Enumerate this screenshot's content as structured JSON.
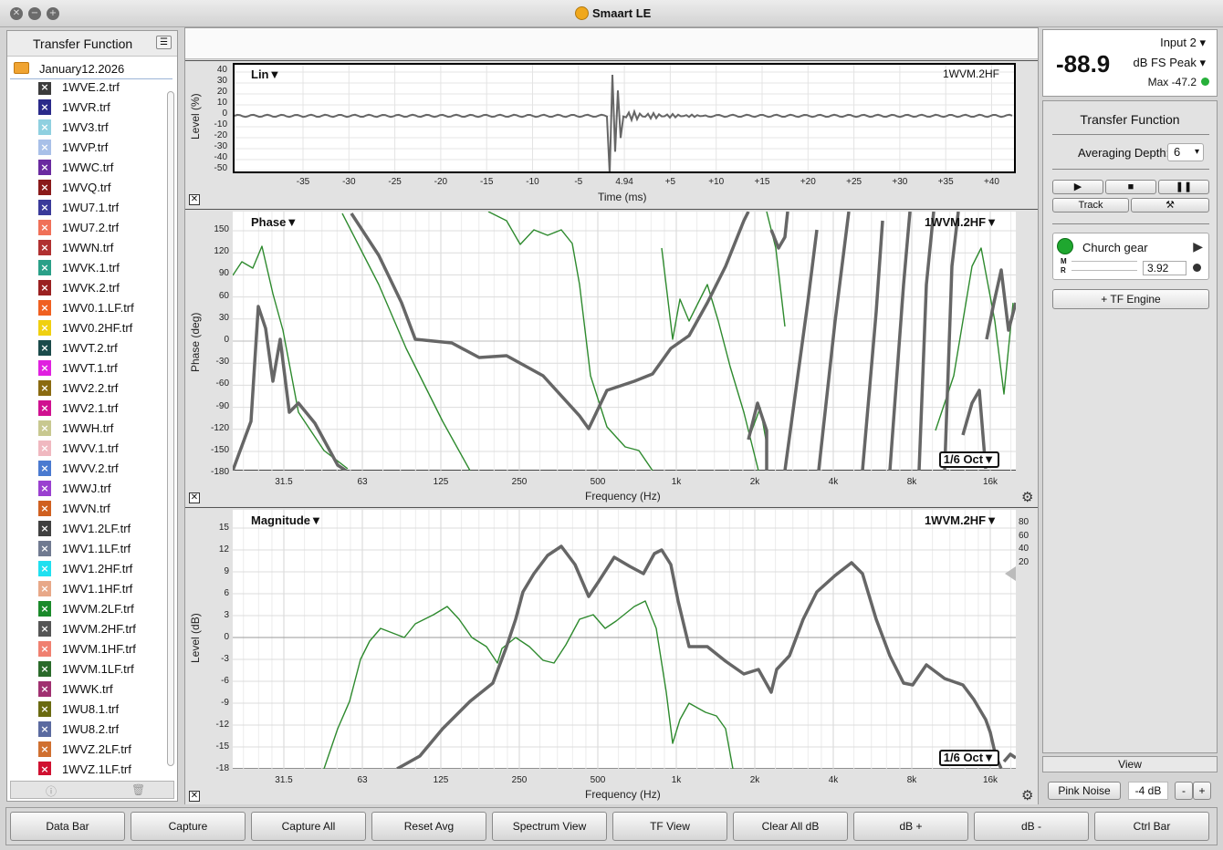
{
  "window": {
    "title": "Smaart LE",
    "close_glyph": "✕",
    "minimize_glyph": "−",
    "zoom_glyph": "+"
  },
  "sidebar": {
    "title": "Transfer Function",
    "folder": "January12.2026",
    "files": [
      {
        "label": "1WVE.2.trf",
        "color": "#3b3b3b"
      },
      {
        "label": "1WVR.trf",
        "color": "#2a2a8a"
      },
      {
        "label": "1WV3.trf",
        "color": "#8fd0e0"
      },
      {
        "label": "1WVP.trf",
        "color": "#a8c0e8"
      },
      {
        "label": "1WWC.trf",
        "color": "#6a2aa0"
      },
      {
        "label": "1WVQ.trf",
        "color": "#8a1a1a"
      },
      {
        "label": "1WU7.1.trf",
        "color": "#3a3a9a"
      },
      {
        "label": "1WU7.2.trf",
        "color": "#f07058"
      },
      {
        "label": "1WWN.trf",
        "color": "#b03030"
      },
      {
        "label": "1WVK.1.trf",
        "color": "#2aa088"
      },
      {
        "label": "1WVK.2.trf",
        "color": "#9a2020"
      },
      {
        "label": "1WV0.1.LF.trf",
        "color": "#f06020"
      },
      {
        "label": "1WV0.2HF.trf",
        "color": "#f0d010"
      },
      {
        "label": "1WVT.2.trf",
        "color": "#1a4a4a"
      },
      {
        "label": "1WVT.1.trf",
        "color": "#e020e0"
      },
      {
        "label": "1WV2.2.trf",
        "color": "#8a6a10"
      },
      {
        "label": "1WV2.1.trf",
        "color": "#d01090"
      },
      {
        "label": "1WWH.trf",
        "color": "#c8c890"
      },
      {
        "label": "1WVV.1.trf",
        "color": "#f0b8c0"
      },
      {
        "label": "1WVV.2.trf",
        "color": "#4a7ad0"
      },
      {
        "label": "1WWJ.trf",
        "color": "#9a40d0"
      },
      {
        "label": "1WVN.trf",
        "color": "#d06020"
      },
      {
        "label": "1WV1.2LF.trf",
        "color": "#404040"
      },
      {
        "label": "1WV1.1LF.trf",
        "color": "#707a90"
      },
      {
        "label": "1WV1.2HF.trf",
        "color": "#20e0f0"
      },
      {
        "label": "1WV1.1HF.trf",
        "color": "#e8a888"
      },
      {
        "label": "1WVM.2LF.trf",
        "color": "#1a8a2a"
      },
      {
        "label": "1WVM.2HF.trf",
        "color": "#555555"
      },
      {
        "label": "1WVM.1HF.trf",
        "color": "#f08070"
      },
      {
        "label": "1WVM.1LF.trf",
        "color": "#2a6a2a"
      },
      {
        "label": "1WWK.trf",
        "color": "#a03070"
      },
      {
        "label": "1WU8.1.trf",
        "color": "#6a6a10"
      },
      {
        "label": "1WU8.2.trf",
        "color": "#5a6aa0"
      },
      {
        "label": "1WVZ.2LF.trf",
        "color": "#d07030"
      },
      {
        "label": "1WVZ.1LF.trf",
        "color": "#d01030"
      }
    ]
  },
  "impulse": {
    "mode": "Lin",
    "trace": "1WVM.2HF",
    "y_label": "Level (%)",
    "x_label": "Time (ms)",
    "y_ticks": [
      "40",
      "30",
      "20",
      "10",
      "0",
      "-10",
      "-20",
      "-30",
      "-40",
      "-50"
    ],
    "x_ticks": [
      "-35",
      "-30",
      "-25",
      "-20",
      "-15",
      "-10",
      "-5",
      "4.94",
      "+5",
      "+10",
      "+15",
      "+20",
      "+25",
      "+30",
      "+35",
      "+40"
    ]
  },
  "phase": {
    "title": "Phase",
    "trace": "1WVM.2HF",
    "y_label": "Phase (deg)",
    "x_label": "Frequency (Hz)",
    "smoothing": "1/6 Oct",
    "y_ticks": [
      "150",
      "120",
      "90",
      "60",
      "30",
      "0",
      "-30",
      "-60",
      "-90",
      "-120",
      "-150",
      "-180"
    ],
    "x_ticks": [
      "31.5",
      "63",
      "125",
      "250",
      "500",
      "1k",
      "2k",
      "4k",
      "8k",
      "16k"
    ]
  },
  "magnitude": {
    "title": "Magnitude",
    "trace": "1WVM.2HF",
    "y_label": "Level (dB)",
    "x_label": "Frequency (Hz)",
    "smoothing": "1/6 Oct",
    "y_ticks": [
      "15",
      "12",
      "9",
      "6",
      "3",
      "0",
      "-3",
      "-6",
      "-9",
      "-12",
      "-15",
      "-18"
    ],
    "right_ticks": [
      "80",
      "60",
      "40",
      "20"
    ],
    "x_ticks": [
      "31.5",
      "63",
      "125",
      "250",
      "500",
      "1k",
      "2k",
      "4k",
      "8k",
      "16k"
    ]
  },
  "meter": {
    "value": "-88.9",
    "input": "Input 2",
    "unit": "dB FS Peak",
    "max": "Max -47.2"
  },
  "tf_panel": {
    "title": "Transfer Function",
    "avg_label": "Averaging Depth:",
    "avg_value": "6",
    "track": "Track",
    "measurement": "Church gear",
    "m_label": "M",
    "r_label": "R",
    "delay": "3.92",
    "tf_engine": "+ TF Engine"
  },
  "view": "View",
  "generator": {
    "label": "Pink Noise",
    "level": "-4 dB",
    "minus": "-",
    "plus": "+"
  },
  "bottom": [
    "Data Bar",
    "Capture",
    "Capture All",
    "Reset Avg",
    "Spectrum View",
    "TF View",
    "Clear All dB",
    "dB +",
    "dB -",
    "Ctrl Bar"
  ]
}
